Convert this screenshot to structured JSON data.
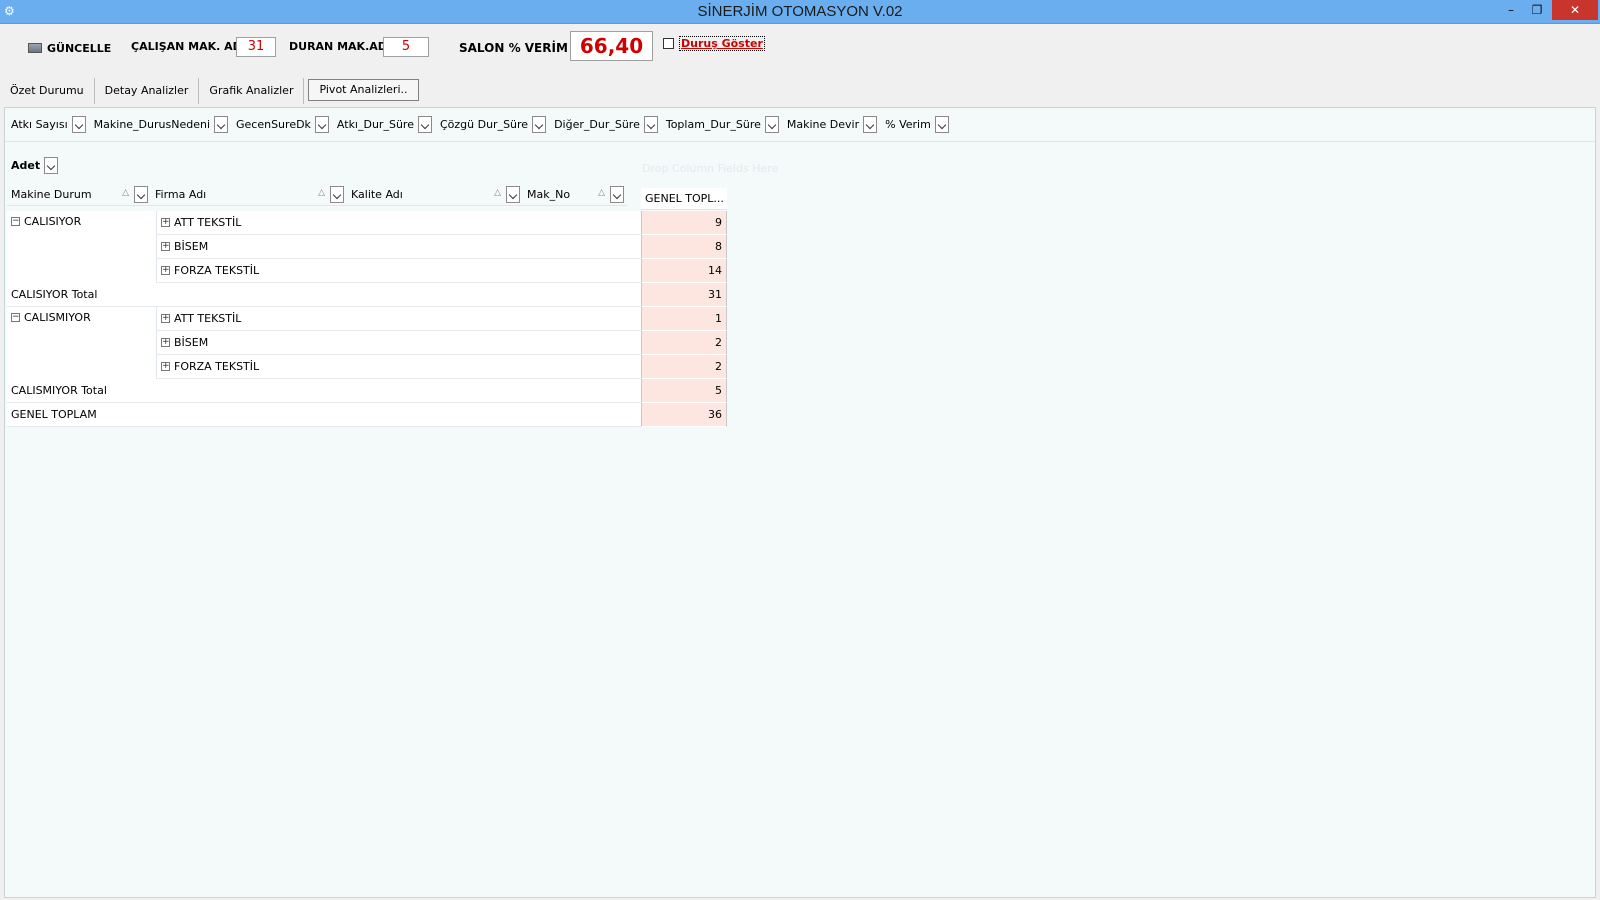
{
  "window": {
    "title": "SİNERJİM OTOMASYON V.02",
    "icon": "gear-icon",
    "controls": {
      "minimize": "–",
      "maximize": "❐",
      "close": "✕"
    }
  },
  "toolbar": {
    "refresh_label": "GÜNCELLE",
    "working_label": "ÇALIŞAN MAK. AD.",
    "working_value": "31",
    "stopped_label": "DURAN MAK.AD.",
    "stopped_value": "5",
    "efficiency_label": "SALON % VERİM",
    "efficiency_value": "66,40",
    "show_stops_label": "Duruş Göster"
  },
  "tabs": [
    {
      "label": "Özet Durumu",
      "active": false
    },
    {
      "label": "Detay Analizler",
      "active": false
    },
    {
      "label": "Grafik Analizler",
      "active": false
    },
    {
      "label": "Pivot Analizleri..",
      "active": true
    }
  ],
  "filter_fields": [
    "Atkı Sayısı",
    "Makine_DurusNedeni",
    "GecenSureDk",
    "Atkı_Dur_Süre",
    "Çözgü Dur_Süre",
    "Diğer_Dur_Süre",
    "Toplam_Dur_Süre",
    "Makine Devir",
    "% Verim"
  ],
  "data_field": "Adet",
  "column_drop_hint": "Drop Column Fields Here",
  "row_fields": [
    {
      "label": "Makine Durum",
      "width": 144
    },
    {
      "label": "Firma Adı",
      "width": 196
    },
    {
      "label": "Kalite Adı",
      "width": 176
    },
    {
      "label": "Mak_No",
      "width": 104
    }
  ],
  "grand_total_header": "GENEL TOPL...",
  "groups": [
    {
      "name": "CALISIYOR",
      "rows": [
        {
          "firm": "ATT TEKSTİL",
          "value": "9"
        },
        {
          "firm": "BİSEM",
          "value": "8"
        },
        {
          "firm": "FORZA TEKSTİL",
          "value": "14"
        }
      ],
      "total_label": "CALISIYOR Total",
      "total_value": "31"
    },
    {
      "name": "CALISMIYOR",
      "rows": [
        {
          "firm": "ATT TEKSTİL",
          "value": "1"
        },
        {
          "firm": "BİSEM",
          "value": "2"
        },
        {
          "firm": "FORZA TEKSTİL",
          "value": "2"
        }
      ],
      "total_label": "CALISMIYOR Total",
      "total_value": "5"
    }
  ],
  "grand_total": {
    "label": "GENEL TOPLAM",
    "value": "36"
  }
}
